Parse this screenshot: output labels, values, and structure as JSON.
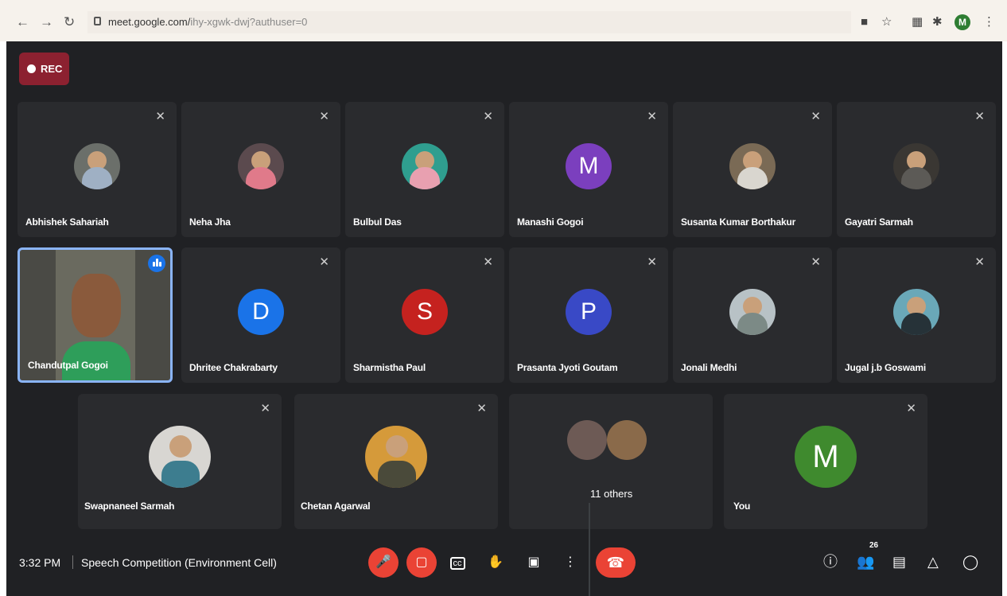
{
  "browser": {
    "url_main": "meet.google.com/",
    "url_rest": "ihy-xgwk-dwj?authuser=0",
    "profile_initial": "M"
  },
  "recording": {
    "label": "REC"
  },
  "participants": [
    {
      "name": "Abhishek Sahariah",
      "avatar": "photo",
      "muted": true,
      "color": "#6b6f6a",
      "body": "#9fb0c4"
    },
    {
      "name": "Neha Jha",
      "avatar": "photo",
      "muted": true,
      "color": "#5b4a4e",
      "body": "#e07a8a"
    },
    {
      "name": "Bulbul Das",
      "avatar": "photo",
      "muted": true,
      "color": "#2f9e8f",
      "body": "#e8a0b0"
    },
    {
      "name": "Manashi Gogoi",
      "avatar": "initial",
      "initial": "M",
      "muted": true,
      "color": "#7b3fbe"
    },
    {
      "name": "Susanta Kumar Borthakur",
      "avatar": "photo",
      "muted": true,
      "color": "#7a6a55",
      "body": "#d9d6cf"
    },
    {
      "name": "Gayatri Sarmah",
      "avatar": "photo",
      "muted": true,
      "color": "#3a3733",
      "body": "#5c5a56"
    },
    {
      "name": "Chandutpal Gogoi",
      "avatar": "video",
      "muted": false,
      "speaking": true
    },
    {
      "name": "Dhritee Chakrabarty",
      "avatar": "initial",
      "initial": "D",
      "muted": true,
      "color": "#1a73e8"
    },
    {
      "name": "Sharmistha Paul",
      "avatar": "initial",
      "initial": "S",
      "muted": true,
      "color": "#c5221f"
    },
    {
      "name": "Prasanta Jyoti Goutam",
      "avatar": "initial",
      "initial": "P",
      "muted": true,
      "color": "#3949c6"
    },
    {
      "name": "Jonali Medhi",
      "avatar": "photo",
      "muted": true,
      "color": "#b8c2c6",
      "body": "#7c8a86"
    },
    {
      "name": "Jugal j.b Goswami",
      "avatar": "photo",
      "muted": true,
      "color": "#6aa8b8",
      "body": "#263238"
    },
    {
      "name": "Swapnaneel Sarmah",
      "avatar": "photo",
      "muted": true,
      "color": "#d8d6d2",
      "body": "#3d7d8f"
    },
    {
      "name": "Chetan Agarwal",
      "avatar": "photo",
      "muted": true,
      "color": "#d59a3a",
      "body": "#4a4a3a"
    },
    {
      "name": "11 others",
      "avatar": "group",
      "muted": false
    },
    {
      "name": "You",
      "avatar": "initial",
      "initial": "M",
      "muted": true,
      "color": "#3f8a2e"
    }
  ],
  "bottom_bar": {
    "time": "3:32 PM",
    "meeting_title": "Speech Competition (Environment Cell)",
    "people_count": "26"
  }
}
